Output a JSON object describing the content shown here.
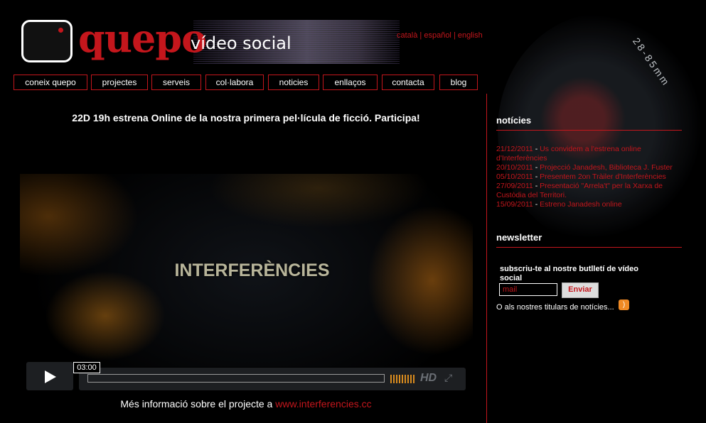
{
  "header": {
    "logo_main": "quepo",
    "logo_sub": "vídeo social",
    "languages": [
      "català",
      "español",
      "english"
    ],
    "language_separator": "|"
  },
  "nav": {
    "items": [
      {
        "label": "coneix quepo"
      },
      {
        "label": "projectes"
      },
      {
        "label": "serveis"
      },
      {
        "label": "col·labora"
      },
      {
        "label": "noticies"
      },
      {
        "label": "enllaços"
      },
      {
        "label": "contacta"
      },
      {
        "label": "blog"
      }
    ]
  },
  "main": {
    "headline": "22D 19h estrena Online de la nostra primera pel·lícula de ficció. Participa!",
    "video": {
      "title": "INTERFERÈNCIES",
      "duration_tooltip": "03:00",
      "hd_label": "HD",
      "fullscreen_icon": "fullscreen-icon",
      "play_icon": "play-icon"
    },
    "more_info_prefix": "Més informació sobre el projecte a ",
    "more_info_link": "www.interferencies.cc"
  },
  "sidebar": {
    "news_heading": "notícies",
    "news": [
      {
        "date": "21/12/2011",
        "sep": " - ",
        "text": "Us convidem a l'estrena online d'Interferències"
      },
      {
        "date": "20/10/2011",
        "sep": " - ",
        "text": "Projecció Janadesh, Biblioteca J. Fuster"
      },
      {
        "date": "05/10/2011",
        "sep": " - ",
        "text": "Presentem 2on Tràiler d'Interferències"
      },
      {
        "date": "27/09/2011",
        "sep": " - ",
        "text": "Presentació \"Arrela't\" per la Xarxa de Custòdia del Territori."
      },
      {
        "date": "15/09/2011",
        "sep": " - ",
        "text": "Estreno Janadesh online"
      }
    ],
    "newsletter_heading": "newsletter",
    "newsletter_label": "subscriu-te al nostre butlletí de vídeo social",
    "mail_placeholder": "mail",
    "send_label": "Enviar",
    "rss_text": "O als nostres titulars de notícies...",
    "lens_text": "28-85mm"
  },
  "colors": {
    "accent": "#c4161c",
    "background": "#000000",
    "rss": "#f08a24"
  }
}
